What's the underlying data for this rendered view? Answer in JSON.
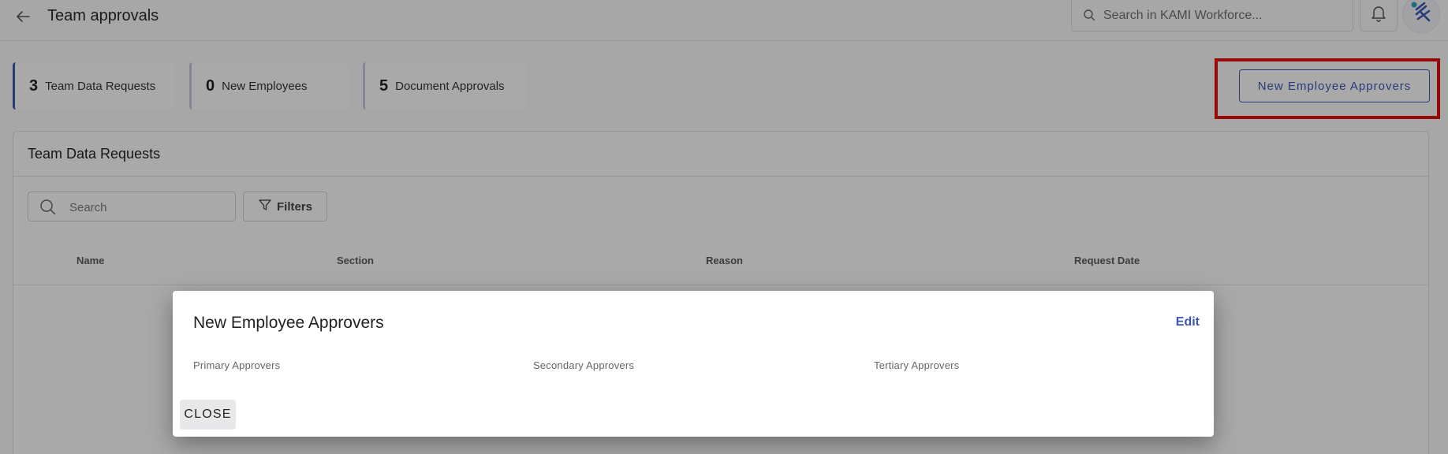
{
  "header": {
    "title": "Team approvals",
    "search_placeholder": "Search in KAMI Workforce..."
  },
  "stats": [
    {
      "count": "3",
      "label": "Team Data Requests"
    },
    {
      "count": "0",
      "label": "New Employees"
    },
    {
      "count": "5",
      "label": "Document Approvals"
    }
  ],
  "approvers_button_label": "New Employee Approvers",
  "panel": {
    "title": "Team Data Requests",
    "search_placeholder": "Search",
    "filters_label": "Filters",
    "columns": [
      "Name",
      "Section",
      "Reason",
      "Request Date"
    ]
  },
  "modal": {
    "title": "New Employee Approvers",
    "edit_label": "Edit",
    "columns": [
      "Primary Approvers",
      "Secondary Approvers",
      "Tertiary Approvers"
    ],
    "close_label": "CLOSE"
  },
  "colors": {
    "accent": "#3b57b0",
    "highlight": "#e01010"
  }
}
